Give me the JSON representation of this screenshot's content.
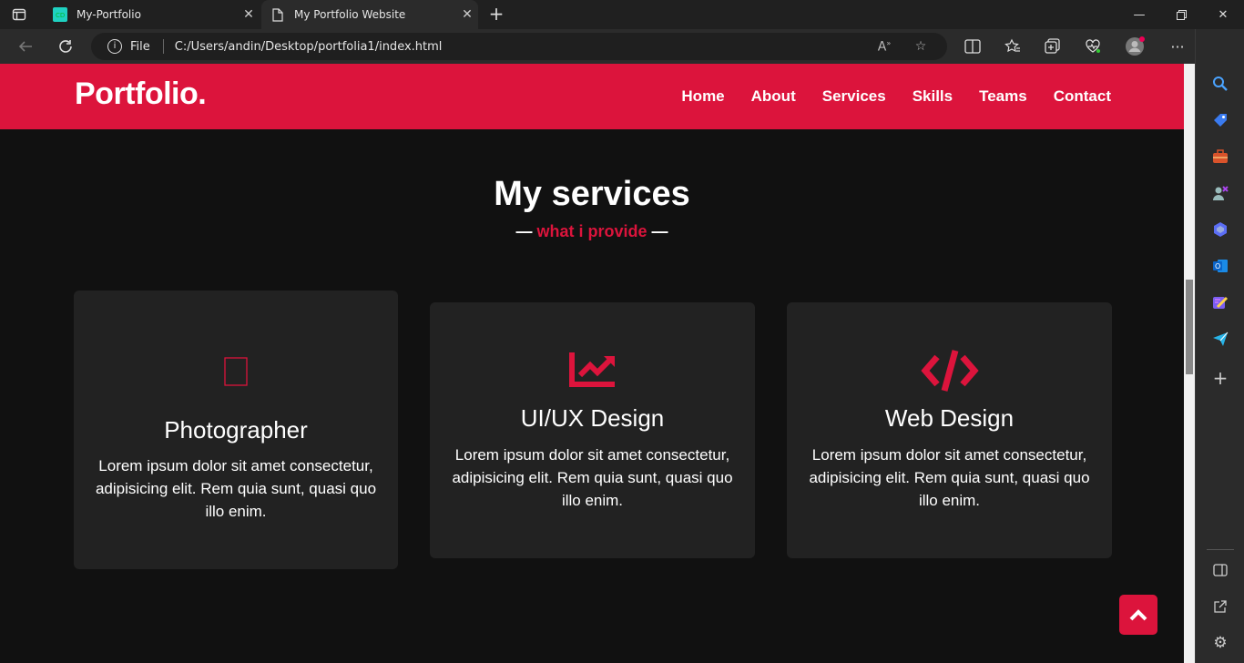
{
  "browser": {
    "tabs": [
      {
        "title": "My-Portfolio",
        "active": false
      },
      {
        "title": "My Portfolio Website",
        "active": true
      }
    ],
    "address": {
      "protocol": "File",
      "url": "C:/Users/andin/Desktop/portfolia1/index.html"
    }
  },
  "site": {
    "logo": "Portfolio.",
    "nav": [
      "Home",
      "About",
      "Services",
      "Skills",
      "Teams",
      "Contact"
    ],
    "section_title": "My services",
    "section_subtitle": "what i provide",
    "services": [
      {
        "title": "Photographer",
        "text": "Lorem ipsum dolor sit amet consectetur, adipisicing elit. Rem quia sunt, quasi quo illo enim.",
        "icon": "missing-glyph-icon"
      },
      {
        "title": "UI/UX Design",
        "text": "Lorem ipsum dolor sit amet consectetur, adipisicing elit. Rem quia sunt, quasi quo illo enim.",
        "icon": "chart-line-icon"
      },
      {
        "title": "Web Design",
        "text": "Lorem ipsum dolor sit amet consectetur, adipisicing elit. Rem quia sunt, quasi quo illo enim.",
        "icon": "code-icon"
      }
    ]
  },
  "colors": {
    "accent": "#dc143c",
    "background": "#111111",
    "card": "#222222"
  }
}
